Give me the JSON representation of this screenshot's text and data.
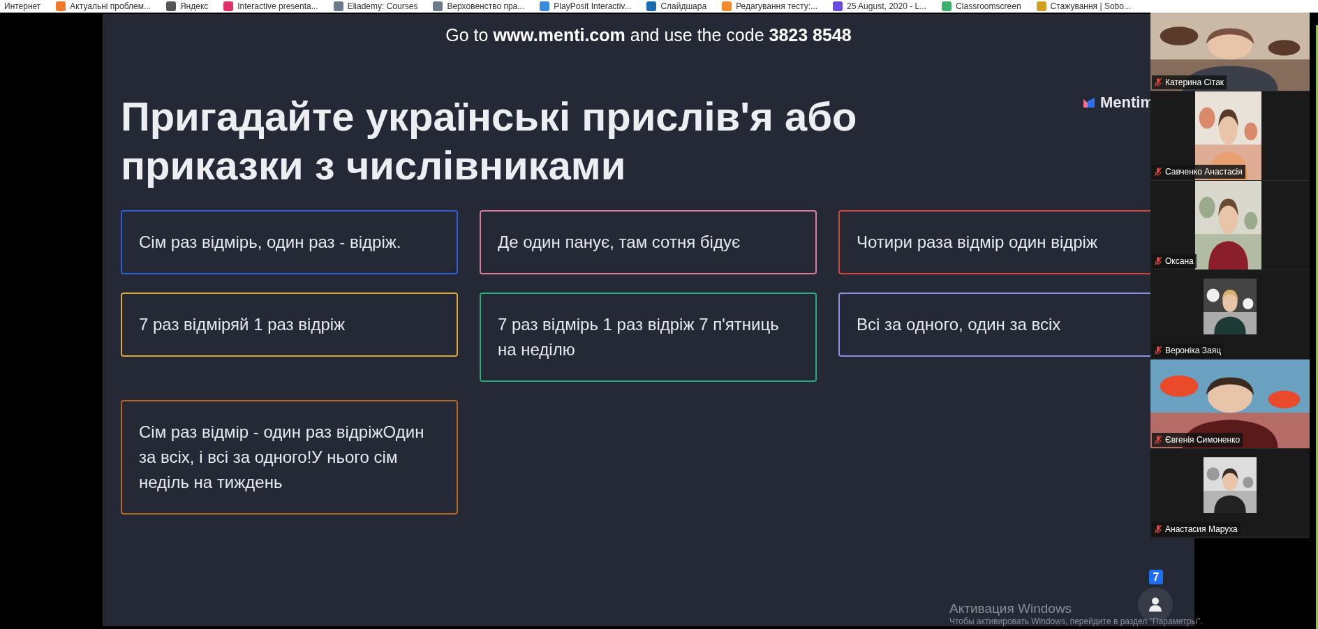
{
  "bookmarks": [
    {
      "label": "Интернет"
    },
    {
      "label": "Актуальні проблем...",
      "color": "#f07a2a"
    },
    {
      "label": "Яндекс",
      "color": "#555555"
    },
    {
      "label": "Interactive presenta...",
      "color": "#e0306a"
    },
    {
      "label": "Eliademy: Courses",
      "color": "#6a7a8a"
    },
    {
      "label": "Верховенство пра...",
      "color": "#6a7a8a"
    },
    {
      "label": "PlayPosit Interactiv...",
      "color": "#3a8ae0"
    },
    {
      "label": "Слайдшара",
      "color": "#1a6ab0"
    },
    {
      "label": "Редагування тесту:...",
      "color": "#f08a2a"
    },
    {
      "label": "25 August, 2020 - L...",
      "color": "#6a4ae0"
    },
    {
      "label": "Classroomscreen",
      "color": "#3ab06a"
    },
    {
      "label": "Стажування | Sobo...",
      "color": "#d0a020"
    }
  ],
  "slide": {
    "instruction": "Go to **www.menti.com** and use the code **3823 8548**",
    "logo": "Mentim",
    "title": "Пригадайте українські прислів'я або приказки з числівниками",
    "answers": [
      {
        "text": "Сім раз відмірь, один раз - відріж.",
        "color": "#2f5fd8"
      },
      {
        "text": "Де один панує, там сотня бідує",
        "color": "#e07a9c"
      },
      {
        "text": "Чотири раза відмір один відріж",
        "color": "#d8453a"
      },
      {
        "text": "7 раз відміряй 1 раз відріж",
        "color": "#dba832"
      },
      {
        "text": "7 раз відмірь 1 раз відріж 7 п'ятниць на неділю",
        "color": "#1fb07a"
      },
      {
        "text": "Всі за одного, один за всіх",
        "color": "#8f8ee2"
      },
      {
        "text": "Сім раз відмір - один раз відріжОдин за всіх, і всі за одного!У нього сім неділь на тиждень",
        "color": "#b8661f"
      }
    ],
    "audience_count": "7"
  },
  "participants": [
    {
      "name": "Катерина Сітак",
      "muted": true,
      "kind": "wide"
    },
    {
      "name": "Савченко Анастасія",
      "muted": true,
      "kind": "narrow"
    },
    {
      "name": "Оксана",
      "muted": true,
      "kind": "narrow"
    },
    {
      "name": "Вероніка Заяц",
      "muted": true,
      "kind": "small"
    },
    {
      "name": "Євгенія Симоненко",
      "muted": true,
      "kind": "wide"
    },
    {
      "name": "Анастасия Маруха",
      "muted": true,
      "kind": "small"
    }
  ],
  "activation": {
    "title": "Активация Windows",
    "text": "Чтобы активировать Windows, перейдите в раздел \"Параметры\"."
  }
}
